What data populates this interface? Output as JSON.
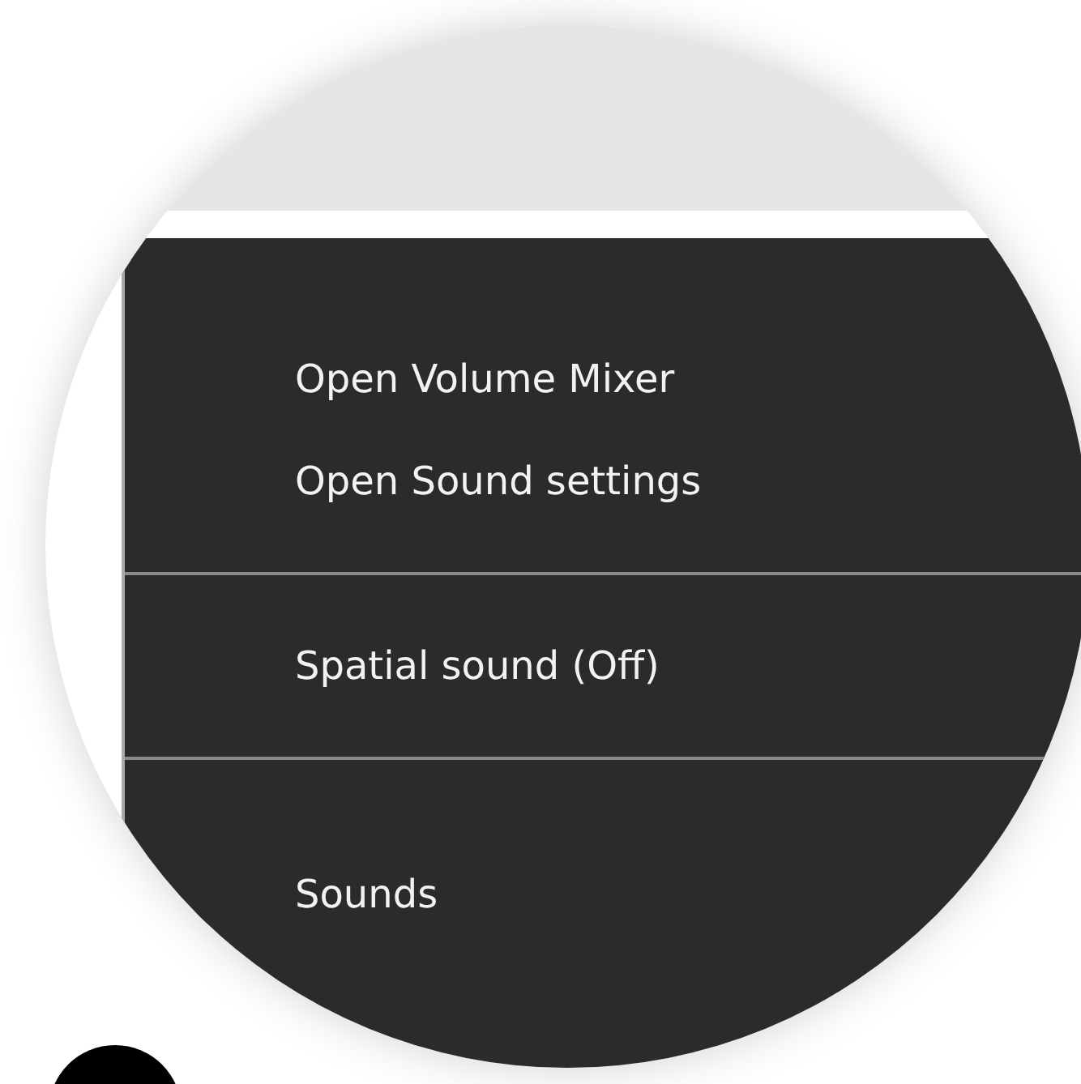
{
  "context_menu": {
    "items": [
      {
        "kind": "item",
        "label": "Open Volume Mixer"
      },
      {
        "kind": "item",
        "label": "Open Sound settings"
      },
      {
        "kind": "separator"
      },
      {
        "kind": "item",
        "label": "Spatial sound (Off)"
      },
      {
        "kind": "separator"
      },
      {
        "kind": "item",
        "label": "Sounds"
      }
    ]
  }
}
